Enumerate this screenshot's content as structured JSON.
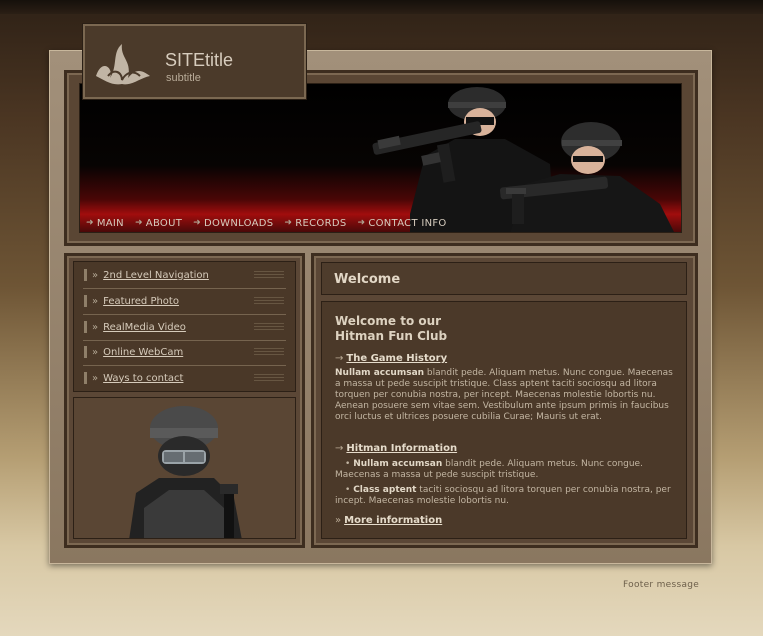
{
  "logo": {
    "title": "SITEtitle",
    "subtitle": "subtitle"
  },
  "nav": {
    "items": [
      {
        "label": "MAIN"
      },
      {
        "label": "ABOUT"
      },
      {
        "label": "DOWNLOADS"
      },
      {
        "label": "RECORDS"
      },
      {
        "label": "CONTACT INFO"
      }
    ]
  },
  "sidebar": {
    "items": [
      {
        "label": "2nd Level Navigation"
      },
      {
        "label": "Featured Photo"
      },
      {
        "label": "RealMedia Video"
      },
      {
        "label": "Online WebCam"
      },
      {
        "label": "Ways to contact"
      }
    ]
  },
  "main": {
    "welcome": "Welcome",
    "title_line1": "Welcome to our",
    "title_line2": "Hitman Fun Club",
    "section1": {
      "heading": "The Game History",
      "lead": "Nullam accumsan",
      "text": " blandit pede. Aliquam metus. Nunc congue. Maecenas a massa ut pede suscipit tristique. Class aptent taciti sociosqu ad litora torquen per conubia nostra, per incept. Maecenas molestie lobortis nu. Aenean posuere sem vitae sem. Vestibulum ante ipsum primis in faucibus orci luctus et ultrices posuere cubilia Curae; Mauris ut erat."
    },
    "section2": {
      "heading": "Hitman Information",
      "bullet1_lead": "Nullam accumsan",
      "bullet1_text": " blandit pede. Aliquam metus. Nunc congue. Maecenas a massa ut pede suscipit tristique.",
      "bullet2_lead": "Class aptent",
      "bullet2_text": " taciti sociosqu ad litora torquen per conubia nostra, per incept. Maecenas molestie lobortis nu."
    },
    "more_link": "More information"
  },
  "footer": {
    "message": "Footer message"
  },
  "icons": {
    "nav_arrow": "arrow-right-icon",
    "sidebar_arrow": "double-chevron-icon",
    "logo": "flame-logo-icon"
  },
  "colors": {
    "frame": "#8a7760",
    "panel": "#4b3929",
    "banner_red": "#a10d0d",
    "text_light": "#d6cbbb"
  }
}
